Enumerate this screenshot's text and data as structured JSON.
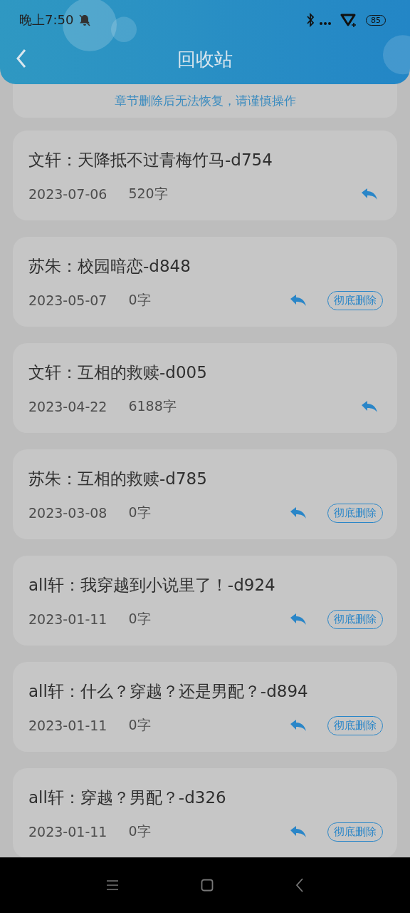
{
  "status_bar": {
    "time": "晚上7:50",
    "battery": "85"
  },
  "header": {
    "title": "回收站"
  },
  "notice": "章节删除后无法恢复，请谨慎操作",
  "items": [
    {
      "title": "文轩：天降抵不过青梅竹马-d754",
      "date": "2023-07-06",
      "words": "520字"
    },
    {
      "title": "苏朱：校园暗恋-d848",
      "date": "2023-05-07",
      "words": "0字",
      "delete_button": "彻底删除"
    },
    {
      "title": "文轩：互相的救赎-d005",
      "date": "2023-04-22",
      "words": "6188字"
    },
    {
      "title": "苏朱：互相的救赎-d785",
      "date": "2023-03-08",
      "words": "0字",
      "delete_button": "彻底删除"
    },
    {
      "title": "all轩：我穿越到小说里了！-d924",
      "date": "2023-01-11",
      "words": "0字",
      "delete_button": "彻底删除"
    },
    {
      "title": "all轩：什么？穿越？还是男配？-d894",
      "date": "2023-01-11",
      "words": "0字",
      "delete_button": "彻底删除"
    },
    {
      "title": "all轩：穿越？男配？-d326",
      "date": "2023-01-11",
      "words": "0字",
      "delete_button": "彻底删除"
    }
  ]
}
